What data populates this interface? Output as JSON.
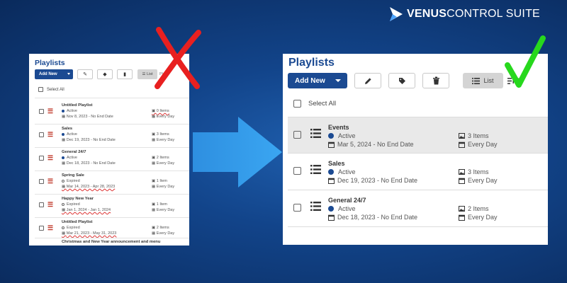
{
  "brand": {
    "bold": "VENUS",
    "light": "CONTROL SUITE"
  },
  "colors": {
    "accent": "#1b4a92",
    "bad": "#e82020",
    "good": "#27d81d",
    "background": "#12448a"
  },
  "before": {
    "title": "Playlists",
    "add_new": "Add New",
    "toolbar_icons": [
      "pencil-icon",
      "tag-icon",
      "trash-icon"
    ],
    "view_list": "List",
    "view_other_partial": "Playli",
    "select_all": "Select All",
    "rows": [
      {
        "name": "Untitled Playlist",
        "status": "Active",
        "dates": "Nov 8, 2023 - No End Date",
        "items": "0 Items",
        "frequency": "Every Day"
      },
      {
        "name": "Sales",
        "status": "Active",
        "dates": "Dec 19, 2023 - No End Date",
        "items": "3 Items",
        "frequency": "Every Day"
      },
      {
        "name": "General 24/7",
        "status": "Active",
        "dates": "Dec 18, 2023 - No End Date",
        "items": "2 Items",
        "frequency": "Every Day"
      },
      {
        "name": "Spring Sale",
        "status": "Expired",
        "dates": "Mar 14, 2023 - Apr 28, 2023",
        "items": "1 Item",
        "frequency": "Every Day"
      },
      {
        "name": "Happy New Year",
        "status": "Expired",
        "dates": "Jan 1, 2024 - Jan 1, 2024",
        "items": "1 Item",
        "frequency": "Every Day"
      },
      {
        "name": "Untitled Playlist",
        "status": "Expired",
        "dates": "Mar 21, 2023 - May 31, 2023",
        "items": "2 Items",
        "frequency": "Every Day"
      }
    ],
    "last_row_name": "Christmas and New Year announcement and menu"
  },
  "after": {
    "title": "Playlists",
    "add_new": "Add New",
    "toolbar_icons": [
      "pencil-icon",
      "tag-icon",
      "trash-icon"
    ],
    "view_list": "List",
    "view_other_partial": "P",
    "select_all": "Select All",
    "rows": [
      {
        "name": "Events",
        "status": "Active",
        "dates": "Mar 5, 2024 - No End Date",
        "items": "3 Items",
        "frequency": "Every Day"
      },
      {
        "name": "Sales",
        "status": "Active",
        "dates": "Dec 19, 2023 - No End Date",
        "items": "3 Items",
        "frequency": "Every Day"
      },
      {
        "name": "General 24/7",
        "status": "Active",
        "dates": "Dec 18, 2023 - No End Date",
        "items": "2 Items",
        "frequency": "Every Day"
      }
    ]
  }
}
